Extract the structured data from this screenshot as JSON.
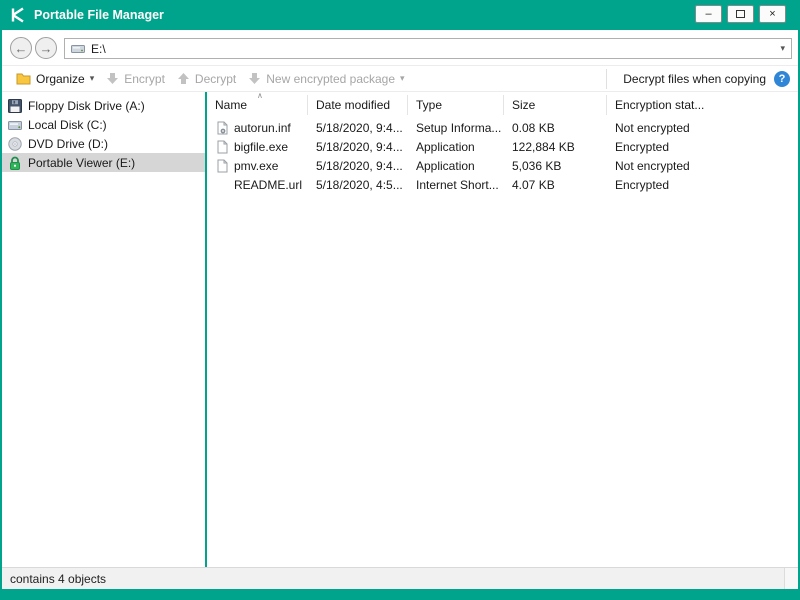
{
  "colors": {
    "accent_teal": "#00a48c",
    "selection_gray": "#d6d6d6",
    "disabled_text": "#a6a6a6",
    "help_blue": "#2f86d6",
    "lock_green": "#2fb457"
  },
  "window": {
    "title": "Portable File Manager",
    "controls": {
      "minimize_glyph": "–",
      "close_glyph": "×"
    }
  },
  "navbar": {
    "back_glyph": "←",
    "forward_glyph": "→",
    "address": "E:\\",
    "dropdown_glyph": "▾"
  },
  "toolbar": {
    "organize_label": "Organize",
    "organize_chevron": "▾",
    "encrypt_label": "Encrypt",
    "decrypt_label": "Decrypt",
    "new_package_label": "New encrypted package",
    "new_package_chevron": "▾",
    "decrypt_copy_label": "Decrypt files when copying",
    "help_glyph": "?"
  },
  "sidebar": {
    "items": [
      {
        "label": "Floppy Disk Drive (A:)"
      },
      {
        "label": "Local Disk (C:)"
      },
      {
        "label": "DVD Drive (D:)"
      },
      {
        "label": "Portable Viewer (E:)"
      }
    ]
  },
  "filelist": {
    "columns": {
      "name": "Name",
      "sort_glyph": "∧",
      "date": "Date modified",
      "type": "Type",
      "size": "Size",
      "encryption": "Encryption stat..."
    },
    "rows": [
      {
        "name": "autorun.inf",
        "date": "5/18/2020, 9:4...",
        "type": "Setup Informa...",
        "size": "0.08 KB",
        "encryption": "Not encrypted"
      },
      {
        "name": "bigfile.exe",
        "date": "5/18/2020, 9:4...",
        "type": "Application",
        "size": "122,884 KB",
        "encryption": "Encrypted"
      },
      {
        "name": "pmv.exe",
        "date": "5/18/2020, 9:4...",
        "type": "Application",
        "size": "5,036 KB",
        "encryption": "Not encrypted"
      },
      {
        "name": "README.url",
        "date": "5/18/2020, 4:5...",
        "type": "Internet Short...",
        "size": "4.07 KB",
        "encryption": "Encrypted"
      }
    ]
  },
  "statusbar": {
    "text": "contains 4 objects"
  }
}
